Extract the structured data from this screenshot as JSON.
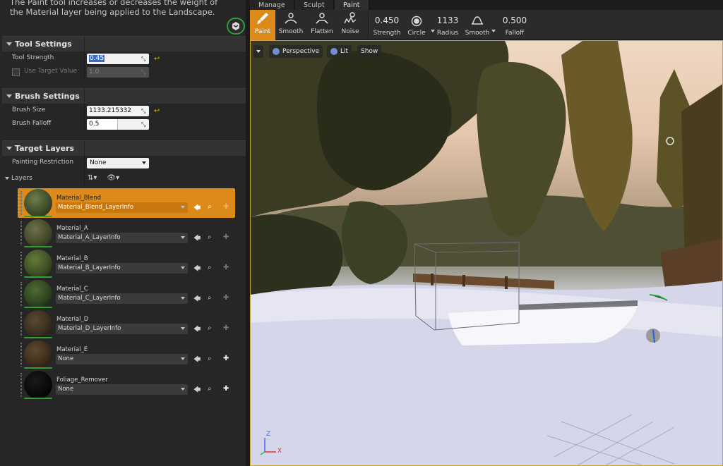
{
  "left_panel": {
    "description": "The Paint tool increases or decreases the weight of the Material layer being applied to the Landscape.",
    "tool_settings": {
      "header": "Tool Settings",
      "tool_strength_label": "Tool Strength",
      "tool_strength_value": "0.45",
      "use_target_value_label": "Use Target Value",
      "target_value": "1.0"
    },
    "brush_settings": {
      "header": "Brush Settings",
      "brush_size_label": "Brush Size",
      "brush_size_value": "1133.215332",
      "brush_falloff_label": "Brush Falloff",
      "brush_falloff_value": "0.5"
    },
    "target_layers": {
      "header": "Target Layers",
      "painting_restriction_label": "Painting Restriction",
      "painting_restriction_value": "None",
      "layers_label": "Layers",
      "layers": [
        {
          "name": "Material_Blend",
          "info": "Material_Blend_LayerInfo"
        },
        {
          "name": "Material_A",
          "info": "Material_A_LayerInfo"
        },
        {
          "name": "Material_B",
          "info": "Material_B_LayerInfo"
        },
        {
          "name": "Material_C",
          "info": "Material_C_LayerInfo"
        },
        {
          "name": "Material_D",
          "info": "Material_D_LayerInfo"
        },
        {
          "name": "Material_E",
          "info": "None"
        },
        {
          "name": "Foliage_Remover",
          "info": "None"
        }
      ]
    }
  },
  "mode_tabs": [
    "Manage",
    "Sculpt",
    "Paint"
  ],
  "toolbar": {
    "tools": [
      "Paint",
      "Smooth",
      "Flatten",
      "Noise"
    ],
    "strength_value": "0.450",
    "strength_label": "Strength",
    "brush_label": "Circle",
    "radius_value": "1133",
    "radius_label": "Radius",
    "falloff_type_label": "Smooth",
    "falloff_value": "0.500",
    "falloff_label": "Falloff"
  },
  "viewport": {
    "perspective_label": "Perspective",
    "lit_label": "Lit",
    "show_label": "Show",
    "axis_z": "Z",
    "axis_x": "X"
  },
  "colors": {
    "accent_orange": "#dc8a1a",
    "reset_yellow": "#d9b814",
    "thumb_green": "#2fa02f"
  }
}
